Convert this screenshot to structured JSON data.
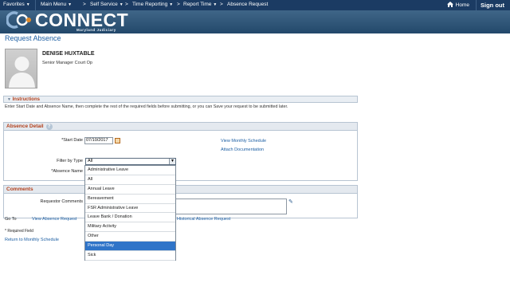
{
  "nav": {
    "favorites": "Favorites",
    "main_menu": "Main Menu",
    "breadcrumbs": [
      "Self Service",
      "Time Reporting",
      "Report Time",
      "Absence Request"
    ],
    "home": "Home",
    "sign_out": "Sign out"
  },
  "brand": {
    "name": "CONNECT",
    "sub": "Maryland Judiciary"
  },
  "page": {
    "title": "Request Absence"
  },
  "employee": {
    "name": "DENISE HUXTABLE",
    "title": "Senior Manager Court Op"
  },
  "instructions": {
    "header": "Instructions",
    "text": "Enter Start Date and Absence Name, then complete the rest of the required fields before submitting, or you can Save your request to be submitted later."
  },
  "absence_detail": {
    "header": "Absence Detail",
    "help": "?",
    "start_date_label": "*Start Date",
    "start_date_value": "07/10/2017",
    "filter_label": "Filter by Type",
    "filter_value": "All",
    "absence_name_label": "*Absence Name",
    "view_schedule": "View Monthly Schedule",
    "attach_doc": "Attach Documentation"
  },
  "filter_options": [
    "Administrative Leave",
    "All",
    "Annual Leave",
    "Bereavement",
    "FSR Administrative Leave",
    "Leave Bank / Donation",
    "Military Activity",
    "Other",
    "Personal Day",
    "Sick"
  ],
  "filter_highlighted": "Personal Day",
  "comments": {
    "header": "Comments",
    "requestor_label": "Requestor Comments"
  },
  "footer": {
    "go_to": "Go To",
    "view_requests": "View Absence Request",
    "historical": "Historical Absence Request",
    "required_note": "* Required Field",
    "return_link": "Return to Monthly Schedule"
  },
  "colors": {
    "nav_bg": "#1b3b63",
    "link": "#1c5ea3",
    "section_title": "#b3411d",
    "highlight": "#2f74c8"
  }
}
